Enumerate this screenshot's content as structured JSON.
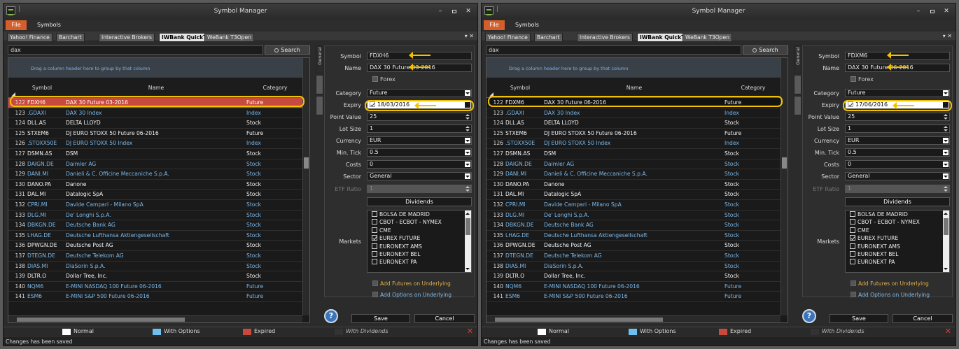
{
  "window_title": "Symbol Manager",
  "menu": {
    "file": "File",
    "symbols": "Symbols"
  },
  "tabs": [
    "Yahoo! Finance",
    "Barchart",
    "Interactive Brokers",
    "IWBank QuickTrade",
    "WeBank T3Open"
  ],
  "active_tab": "IWBank QuickTrade",
  "search": {
    "value": "dax",
    "button": "Search"
  },
  "grid": {
    "group_hint": "Drag a column header here to group by that column",
    "columns": {
      "symbol": "Symbol",
      "name": "Name",
      "category": "Category"
    }
  },
  "side_tabs": [
    "General"
  ],
  "field_labels": {
    "symbol": "Symbol",
    "name": "Name",
    "forex": "Forex",
    "category": "Category",
    "expiry": "Expiry",
    "point_value": "Point Value",
    "lot_size": "Lot Size",
    "currency": "Currency",
    "min_tick": "Min. Tick",
    "costs": "Costs",
    "sector": "Sector",
    "etf_ratio": "ETF Ratio",
    "dividends": "Dividends",
    "markets": "Markets",
    "add_futures": "Add Futures on Underlying",
    "add_options": "Add Options on Underlying"
  },
  "markets_list": [
    "BOLSA DE MADRID",
    "CBOT - ECBOT - NYMEX",
    "CME",
    "EUREX FUTURE",
    "EURONEXT AMS",
    "EURONEXT BEL",
    "EURONEXT PA"
  ],
  "buttons": {
    "save": "Save",
    "cancel": "Cancel",
    "help": "?"
  },
  "legend": {
    "normal": "Normal",
    "with_options": "With Options",
    "expired": "Expired",
    "with_dividends": "With Dividends"
  },
  "colors": {
    "expired": "#c84a3f",
    "with_options": "#6ec0ee",
    "normal": "#ffffff",
    "highlight": "#f2c200",
    "file_menu": "#d55e2a"
  },
  "status": "Changes has been saved",
  "panes": [
    {
      "rows": [
        {
          "num": "122",
          "symbol": "FDXH6",
          "name": "DAX 30 Future 03-2016",
          "category": "Future",
          "kind": "expired"
        },
        {
          "num": "123",
          "symbol": ".GDAXI",
          "name": "DAX 30 Index",
          "category": "Index",
          "kind": "option"
        },
        {
          "num": "124",
          "symbol": "DLL.AS",
          "name": "DELTA LLOYD",
          "category": "Stock",
          "kind": "stock"
        },
        {
          "num": "125",
          "symbol": "STXEM6",
          "name": "DJ EURO STOXX 50 Future 06-2016",
          "category": "Future",
          "kind": "future"
        },
        {
          "num": "126",
          "symbol": ".STOXX50E",
          "name": "DJ EURO STOXX 50 Index",
          "category": "Index",
          "kind": "option"
        },
        {
          "num": "127",
          "symbol": "DSMN.AS",
          "name": "DSM",
          "category": "Stock",
          "kind": "stock"
        },
        {
          "num": "128",
          "symbol": "DAIGN.DE",
          "name": "Daimler AG",
          "category": "Stock",
          "kind": "option"
        },
        {
          "num": "129",
          "symbol": "DANI.MI",
          "name": "Danieli & C. Officine Meccaniche S.p.A.",
          "category": "Stock",
          "kind": "option"
        },
        {
          "num": "130",
          "symbol": "DANO.PA",
          "name": "Danone",
          "category": "Stock",
          "kind": "stock"
        },
        {
          "num": "131",
          "symbol": "DAL.MI",
          "name": "Datalogic SpA",
          "category": "Stock",
          "kind": "stock"
        },
        {
          "num": "132",
          "symbol": "CPRI.MI",
          "name": "Davide Campari - Milano SpA",
          "category": "Stock",
          "kind": "option"
        },
        {
          "num": "133",
          "symbol": "DLG.MI",
          "name": "De' Longhi S.p.A.",
          "category": "Stock",
          "kind": "option"
        },
        {
          "num": "134",
          "symbol": "DBKGN.DE",
          "name": "Deutsche Bank AG",
          "category": "Stock",
          "kind": "option"
        },
        {
          "num": "135",
          "symbol": "LHAG.DE",
          "name": "Deutsche Lufthansa Aktiengesellschaft",
          "category": "Stock",
          "kind": "option"
        },
        {
          "num": "136",
          "symbol": "DPWGN.DE",
          "name": "Deutsche Post AG",
          "category": "Stock",
          "kind": "stock"
        },
        {
          "num": "137",
          "symbol": "DTEGN.DE",
          "name": "Deutsche Telekom AG",
          "category": "Stock",
          "kind": "option"
        },
        {
          "num": "138",
          "symbol": "DIAS.MI",
          "name": "DiaSorin S.p.A.",
          "category": "Stock",
          "kind": "option"
        },
        {
          "num": "139",
          "symbol": "DLTR.O",
          "name": "Dollar Tree, Inc.",
          "category": "Stock",
          "kind": "stock"
        },
        {
          "num": "140",
          "symbol": "NQM6",
          "name": "E-MINI NASDAQ 100 Future 06-2016",
          "category": "Future",
          "kind": "option"
        },
        {
          "num": "141",
          "symbol": "ESM6",
          "name": "E-MINI S&P 500 Future 06-2016",
          "category": "Future",
          "kind": "option"
        }
      ],
      "form": {
        "symbol": "FDXH6",
        "name": "DAX 30 Future 03-2016",
        "category": "Future",
        "expiry": "18/03/2016",
        "point_value": "25",
        "lot_size": "1",
        "currency": "EUR",
        "min_tick": "0.5",
        "costs": "0",
        "sector": "General",
        "etf_ratio": "1"
      },
      "checked_market": "EUREX FUTURE"
    },
    {
      "rows": [
        {
          "num": "122",
          "symbol": "FDXM6",
          "name": "DAX 30 Future 06-2016",
          "category": "Future",
          "kind": "future"
        },
        {
          "num": "123",
          "symbol": ".GDAXI",
          "name": "DAX 30 Index",
          "category": "Index",
          "kind": "option"
        },
        {
          "num": "124",
          "symbol": "DLL.AS",
          "name": "DELTA LLOYD",
          "category": "Stock",
          "kind": "stock"
        },
        {
          "num": "125",
          "symbol": "STXEM6",
          "name": "DJ EURO STOXX 50 Future 06-2016",
          "category": "Future",
          "kind": "future"
        },
        {
          "num": "126",
          "symbol": ".STOXX50E",
          "name": "DJ EURO STOXX 50 Index",
          "category": "Index",
          "kind": "option"
        },
        {
          "num": "127",
          "symbol": "DSMN.AS",
          "name": "DSM",
          "category": "Stock",
          "kind": "stock"
        },
        {
          "num": "128",
          "symbol": "DAIGN.DE",
          "name": "Daimler AG",
          "category": "Stock",
          "kind": "option"
        },
        {
          "num": "129",
          "symbol": "DANI.MI",
          "name": "Danieli & C. Officine Meccaniche S.p.A.",
          "category": "Stock",
          "kind": "option"
        },
        {
          "num": "130",
          "symbol": "DANO.PA",
          "name": "Danone",
          "category": "Stock",
          "kind": "stock"
        },
        {
          "num": "131",
          "symbol": "DAL.MI",
          "name": "Datalogic SpA",
          "category": "Stock",
          "kind": "stock"
        },
        {
          "num": "132",
          "symbol": "CPRI.MI",
          "name": "Davide Campari - Milano SpA",
          "category": "Stock",
          "kind": "option"
        },
        {
          "num": "133",
          "symbol": "DLG.MI",
          "name": "De' Longhi S.p.A.",
          "category": "Stock",
          "kind": "option"
        },
        {
          "num": "134",
          "symbol": "DBKGN.DE",
          "name": "Deutsche Bank AG",
          "category": "Stock",
          "kind": "option"
        },
        {
          "num": "135",
          "symbol": "LHAG.DE",
          "name": "Deutsche Lufthansa Aktiengesellschaft",
          "category": "Stock",
          "kind": "option"
        },
        {
          "num": "136",
          "symbol": "DPWGN.DE",
          "name": "Deutsche Post AG",
          "category": "Stock",
          "kind": "stock"
        },
        {
          "num": "137",
          "symbol": "DTEGN.DE",
          "name": "Deutsche Telekom AG",
          "category": "Stock",
          "kind": "option"
        },
        {
          "num": "138",
          "symbol": "DIAS.MI",
          "name": "DiaSorin S.p.A.",
          "category": "Stock",
          "kind": "option"
        },
        {
          "num": "139",
          "symbol": "DLTR.O",
          "name": "Dollar Tree, Inc.",
          "category": "Stock",
          "kind": "stock"
        },
        {
          "num": "140",
          "symbol": "NQM6",
          "name": "E-MINI NASDAQ 100 Future 06-2016",
          "category": "Future",
          "kind": "option"
        },
        {
          "num": "141",
          "symbol": "ESM6",
          "name": "E-MINI S&P 500 Future 06-2016",
          "category": "Future",
          "kind": "option"
        }
      ],
      "form": {
        "symbol": "FDXM6",
        "name": "DAX 30 Future 06-2016",
        "category": "Future",
        "expiry": "17/06/2016",
        "point_value": "25",
        "lot_size": "1",
        "currency": "EUR",
        "min_tick": "0.5",
        "costs": "0",
        "sector": "General",
        "etf_ratio": "1"
      },
      "checked_market": "EUREX FUTURE"
    }
  ]
}
